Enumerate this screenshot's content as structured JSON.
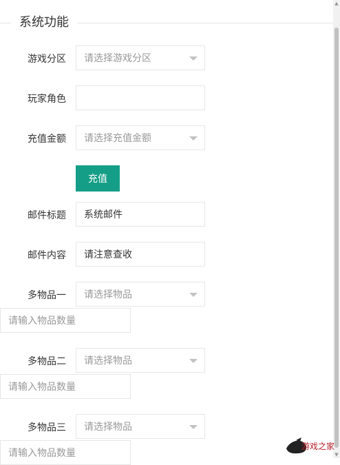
{
  "header": {
    "title": "系统功能"
  },
  "form": {
    "zone": {
      "label": "游戏分区",
      "placeholder": "请选择游戏分区"
    },
    "role": {
      "label": "玩家角色",
      "value": ""
    },
    "amount": {
      "label": "充值金额",
      "placeholder": "请选择充值金额"
    },
    "charge_button": "充值",
    "mail_title": {
      "label": "邮件标题",
      "value": "系统邮件"
    },
    "mail_content": {
      "label": "邮件内容",
      "value": "请注意查收"
    },
    "items": [
      {
        "label": "多物品一",
        "placeholder": "请选择物品",
        "qty_placeholder": "请输入物品数量"
      },
      {
        "label": "多物品二",
        "placeholder": "请选择物品",
        "qty_placeholder": "请输入物品数量"
      },
      {
        "label": "多物品三",
        "placeholder": "请选择物品",
        "qty_placeholder": "请输入物品数量"
      }
    ]
  },
  "watermark": {
    "text": "游戏之家"
  },
  "colors": {
    "accent": "#159e87",
    "border": "#e6e6e6",
    "placeholder": "#999999"
  }
}
